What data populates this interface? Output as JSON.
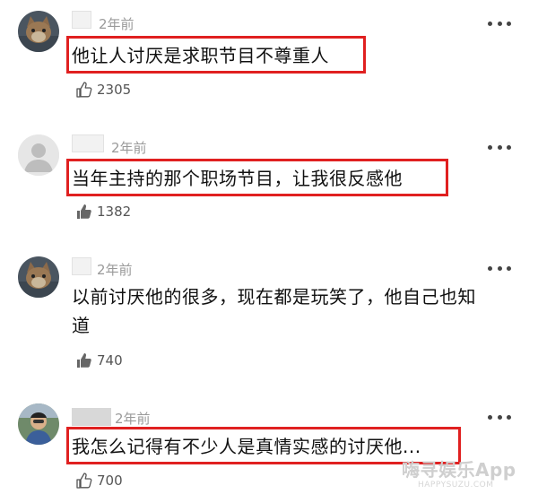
{
  "comments": [
    {
      "time": "2年前",
      "text": "他让人讨厌是求职节目不尊重人",
      "likes": "2305",
      "avatar": "cat-photo-avatar",
      "like_icon": "thumbs-up-outline-icon"
    },
    {
      "time": "2年前",
      "text": "当年主持的那个职场节目，让我很反感他",
      "likes": "1382",
      "avatar": "default-gray-avatar",
      "like_icon": "thumbs-up-filled-icon"
    },
    {
      "time": "2年前",
      "text_line1": "以前讨厌他的很多，现在都是玩笑了，他自己也知",
      "text_line2": "道",
      "likes": "740",
      "avatar": "cat-photo-avatar",
      "like_icon": "thumbs-up-filled-icon"
    },
    {
      "time": "2年前",
      "text": "我怎么记得有不少人是真情实感的讨厌他...",
      "likes": "700",
      "avatar": "person-photo-avatar",
      "like_icon": "thumbs-up-outline-icon"
    }
  ],
  "watermark": {
    "main": "嗨寻娱乐App",
    "sub": "HAPPYSUZU.COM"
  },
  "colors": {
    "highlight_border": "#e02020",
    "meta_text": "#9a9a9a"
  }
}
